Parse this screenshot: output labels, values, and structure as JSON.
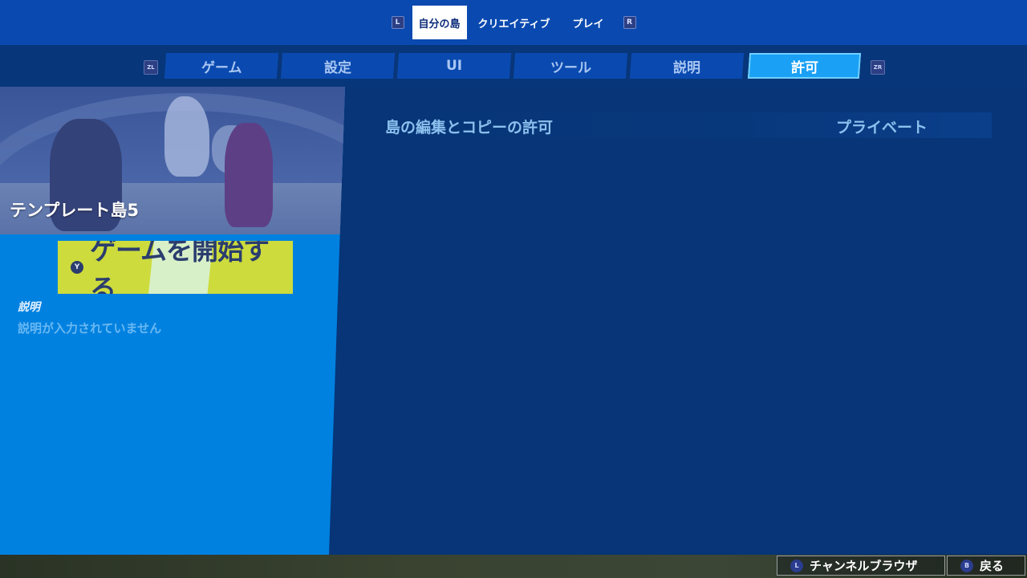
{
  "top_tabs": {
    "left_hint": "L",
    "right_hint": "R",
    "items": [
      {
        "label": "自分の島",
        "active": true
      },
      {
        "label": "クリエイティブ",
        "active": false
      },
      {
        "label": "プレイ",
        "active": false
      }
    ]
  },
  "sub_tabs": {
    "left_hint": "ZL",
    "right_hint": "ZR",
    "items": [
      {
        "label": "ゲーム",
        "active": false
      },
      {
        "label": "設定",
        "active": false
      },
      {
        "label": "UI",
        "active": false
      },
      {
        "label": "ツール",
        "active": false
      },
      {
        "label": "説明",
        "active": false
      },
      {
        "label": "許可",
        "active": true
      }
    ]
  },
  "island": {
    "title": "テンプレート島5",
    "start_button": {
      "hint": "Y",
      "label": "ゲームを開始する"
    },
    "description_heading": "説明",
    "description_text": "説明が入力されていません"
  },
  "settings": [
    {
      "label": "島の編集とコピーの許可",
      "value": "プライベート"
    }
  ],
  "bottom_bar": {
    "channel": {
      "hint": "L",
      "label": "チャンネルブラウザ"
    },
    "back": {
      "hint": "B",
      "label": "戻る"
    }
  },
  "colors": {
    "background": "#073577",
    "top_bar": "#0a4ab0",
    "left_panel": "#0081e0",
    "active_sub_tab": "#1aa0f5",
    "start_button": "#cddc3c"
  }
}
